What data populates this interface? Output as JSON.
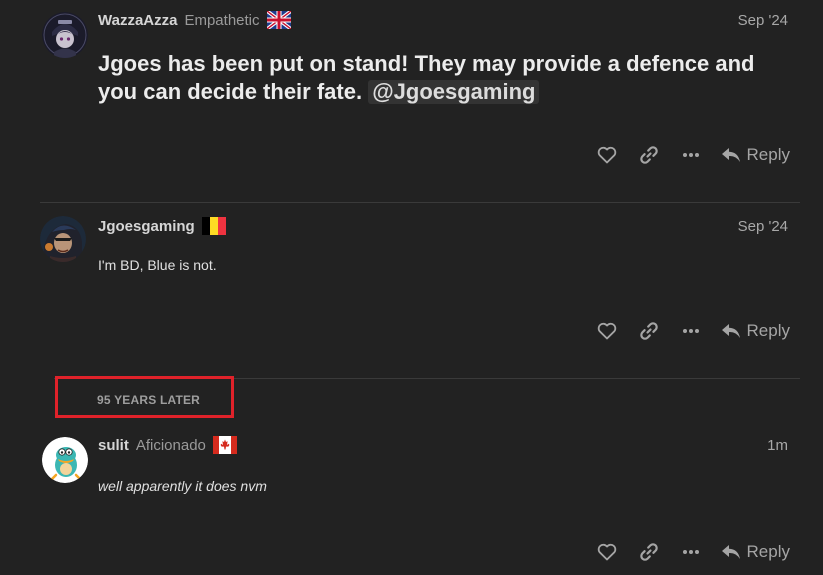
{
  "posts": [
    {
      "username": "WazzaAzza",
      "user_title": "Empathetic",
      "flag": "uk-flag",
      "date": "Sep '24",
      "body_text": "Jgoes has been put on stand! They may provide a defence and you can decide their fate.",
      "mention": "@Jgoesgaming",
      "reply_label": "Reply"
    },
    {
      "username": "Jgoesgaming",
      "user_title": "",
      "flag": "belgium-flag",
      "date": "Sep '24",
      "body_text": "I'm BD, Blue is not.",
      "reply_label": "Reply"
    },
    {
      "username": "sulit",
      "user_title": "Aficionado",
      "flag": "canada-flag",
      "date": "1m",
      "body_text": "well apparently it does nvm",
      "reply_label": "Reply"
    }
  ],
  "time_gap": {
    "label": "95 YEARS LATER"
  },
  "colors": {
    "background": "#222222",
    "highlight_border": "#e0222a",
    "divider": "#3a3a3a"
  },
  "icons": [
    "heart-icon",
    "link-icon",
    "more-icon",
    "reply-icon"
  ]
}
